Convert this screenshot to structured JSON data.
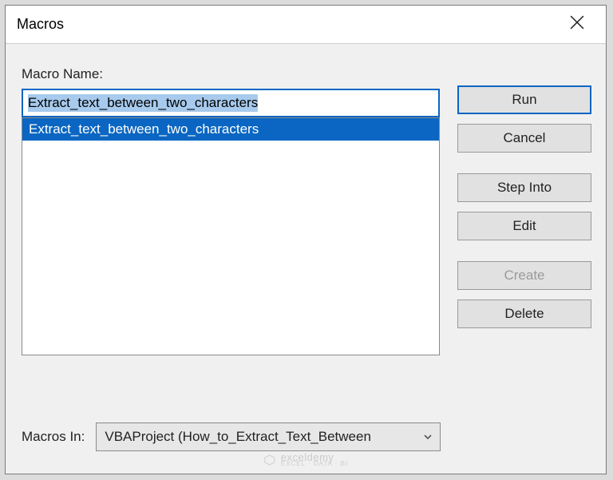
{
  "dialog": {
    "title": "Macros",
    "macro_name_label": "Macro Name:",
    "macro_name_value": "Extract_text_between_two_characters",
    "list_items": [
      "Extract_text_between_two_characters"
    ],
    "macros_in_label": "Macros In:",
    "macros_in_value": "VBAProject (How_to_Extract_Text_Between"
  },
  "buttons": {
    "run": "Run",
    "cancel": "Cancel",
    "step_into": "Step Into",
    "edit": "Edit",
    "create": "Create",
    "delete": "Delete"
  },
  "watermark": {
    "brand": "exceldemy",
    "sub": "EXCEL · DATA · BI"
  }
}
